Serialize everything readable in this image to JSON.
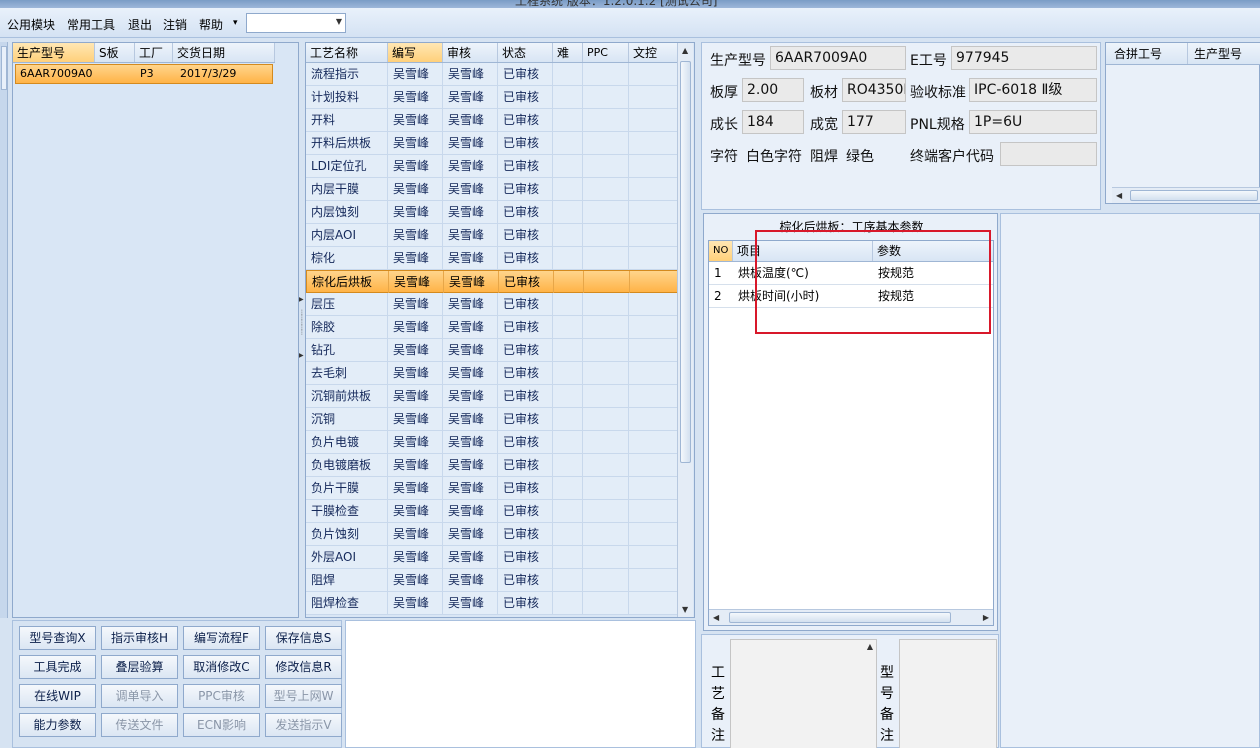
{
  "window": {
    "title": "工程系统  版本：1.2.0.1.2  [测试公司]"
  },
  "menu": {
    "items": [
      "公用模块",
      "常用工具",
      "退出",
      "注销",
      "帮助"
    ],
    "help_arrow": "▾",
    "combo_value": ""
  },
  "left_list": {
    "columns": [
      "生产型号",
      "S板",
      "工厂",
      "交货日期"
    ],
    "row": {
      "model": "6AAR7009A0",
      "s_board": "",
      "factory": "P3",
      "delivery_date": "2017/3/29"
    }
  },
  "process_grid": {
    "columns": [
      "工艺名称",
      "编写",
      "审核",
      "状态",
      "难",
      "PPC",
      "文控"
    ],
    "selected_index": 9,
    "rows": [
      {
        "name": "流程指示",
        "writer": "吴雪峰",
        "reviewer": "吴雪峰",
        "status": "已审核"
      },
      {
        "name": "计划投料",
        "writer": "吴雪峰",
        "reviewer": "吴雪峰",
        "status": "已审核"
      },
      {
        "name": "开料",
        "writer": "吴雪峰",
        "reviewer": "吴雪峰",
        "status": "已审核"
      },
      {
        "name": "开料后烘板",
        "writer": "吴雪峰",
        "reviewer": "吴雪峰",
        "status": "已审核"
      },
      {
        "name": "LDI定位孔",
        "writer": "吴雪峰",
        "reviewer": "吴雪峰",
        "status": "已审核"
      },
      {
        "name": "内层干膜",
        "writer": "吴雪峰",
        "reviewer": "吴雪峰",
        "status": "已审核"
      },
      {
        "name": "内层蚀刻",
        "writer": "吴雪峰",
        "reviewer": "吴雪峰",
        "status": "已审核"
      },
      {
        "name": "内层AOI",
        "writer": "吴雪峰",
        "reviewer": "吴雪峰",
        "status": "已审核"
      },
      {
        "name": "棕化",
        "writer": "吴雪峰",
        "reviewer": "吴雪峰",
        "status": "已审核"
      },
      {
        "name": "棕化后烘板",
        "writer": "吴雪峰",
        "reviewer": "吴雪峰",
        "status": "已审核"
      },
      {
        "name": "层压",
        "writer": "吴雪峰",
        "reviewer": "吴雪峰",
        "status": "已审核"
      },
      {
        "name": "除胶",
        "writer": "吴雪峰",
        "reviewer": "吴雪峰",
        "status": "已审核"
      },
      {
        "name": "钻孔",
        "writer": "吴雪峰",
        "reviewer": "吴雪峰",
        "status": "已审核"
      },
      {
        "name": "去毛刺",
        "writer": "吴雪峰",
        "reviewer": "吴雪峰",
        "status": "已审核"
      },
      {
        "name": "沉铜前烘板",
        "writer": "吴雪峰",
        "reviewer": "吴雪峰",
        "status": "已审核"
      },
      {
        "name": "沉铜",
        "writer": "吴雪峰",
        "reviewer": "吴雪峰",
        "status": "已审核"
      },
      {
        "name": "负片电镀",
        "writer": "吴雪峰",
        "reviewer": "吴雪峰",
        "status": "已审核"
      },
      {
        "name": "负电镀磨板",
        "writer": "吴雪峰",
        "reviewer": "吴雪峰",
        "status": "已审核"
      },
      {
        "name": "负片干膜",
        "writer": "吴雪峰",
        "reviewer": "吴雪峰",
        "status": "已审核"
      },
      {
        "name": "干膜检查",
        "writer": "吴雪峰",
        "reviewer": "吴雪峰",
        "status": "已审核"
      },
      {
        "name": "负片蚀刻",
        "writer": "吴雪峰",
        "reviewer": "吴雪峰",
        "status": "已审核"
      },
      {
        "name": "外层AOI",
        "writer": "吴雪峰",
        "reviewer": "吴雪峰",
        "status": "已审核"
      },
      {
        "name": "阻焊",
        "writer": "吴雪峰",
        "reviewer": "吴雪峰",
        "status": "已审核"
      },
      {
        "name": "阻焊检查",
        "writer": "吴雪峰",
        "reviewer": "吴雪峰",
        "status": "已审核"
      }
    ]
  },
  "buttons": [
    {
      "label": "型号查询X",
      "enabled": true
    },
    {
      "label": "指示审核H",
      "enabled": true
    },
    {
      "label": "编写流程F",
      "enabled": true
    },
    {
      "label": "保存信息S",
      "enabled": true
    },
    {
      "label": "工具完成",
      "enabled": true
    },
    {
      "label": "叠层验算",
      "enabled": true
    },
    {
      "label": "取消修改C",
      "enabled": true
    },
    {
      "label": "修改信息R",
      "enabled": true
    },
    {
      "label": "在线WIP",
      "enabled": true
    },
    {
      "label": "调单导入",
      "enabled": false
    },
    {
      "label": "PPC审核",
      "enabled": false
    },
    {
      "label": "型号上网W",
      "enabled": false
    },
    {
      "label": "能力参数",
      "enabled": true
    },
    {
      "label": "传送文件",
      "enabled": false
    },
    {
      "label": "ECN影响",
      "enabled": false
    },
    {
      "label": "发送指示V",
      "enabled": false
    }
  ],
  "info": {
    "model_label": "生产型号",
    "model_value": "6AAR7009A0",
    "e_label": "E工号",
    "e_value": "977945",
    "thickness_label": "板厚",
    "thickness_value": "2.00",
    "material_label": "板材",
    "material_value": "RO4350B",
    "standard_label": "验收标准",
    "standard_value": "IPC-6018 Ⅱ级",
    "length_label": "成长",
    "length_value": "184",
    "width_label": "成宽",
    "width_value": "177",
    "pnl_label": "PNL规格",
    "pnl_value": "1P=6U",
    "char_label": "字符",
    "char_value": "白色字符",
    "mask_label": "阻焊",
    "mask_value": "绿色",
    "customer_label": "终端客户代码",
    "customer_value": ""
  },
  "merge_grid": {
    "columns": [
      "合拼工号",
      "生产型号"
    ]
  },
  "params": {
    "title": "棕化后烘板：工序基本参数",
    "columns": [
      "NO",
      "项目",
      "参数"
    ],
    "rows": [
      {
        "no": "1",
        "item": "烘板温度(℃)",
        "value": "按规范"
      },
      {
        "no": "2",
        "item": "烘板时间(小时)",
        "value": "按规范"
      }
    ]
  },
  "remarks": {
    "process_label": [
      "工",
      "艺",
      "备",
      "注"
    ],
    "model_label": [
      "型",
      "号",
      "备",
      "注"
    ]
  },
  "colors": {
    "accent_selection": "#ffb347",
    "highlight_box": "#d8182a"
  }
}
